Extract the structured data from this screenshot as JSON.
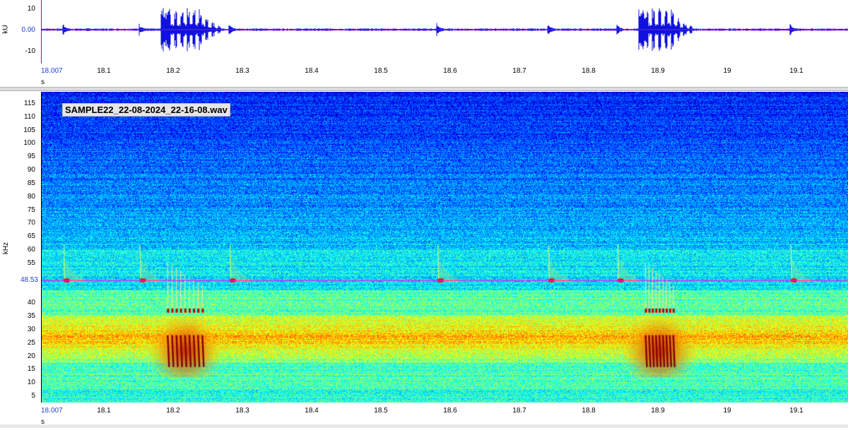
{
  "waveform": {
    "y_unit": "kU",
    "x_unit": "s",
    "y_ticks": [
      "10",
      "0.00",
      "-10"
    ],
    "y_ticks_values": [
      10,
      0,
      -10
    ],
    "y_range": [
      -15,
      15
    ],
    "x_start_label": "18.007",
    "x_ticks": [
      "18.1",
      "18.2",
      "18.3",
      "18.4",
      "18.5",
      "18.6",
      "18.7",
      "18.8",
      "18.9",
      "19",
      "19.1"
    ],
    "colors": {
      "signal": "#1010e0",
      "zero_line": "#c000c0",
      "axis": "#cc0066"
    }
  },
  "spectrogram": {
    "file_name": "SAMPLE22_22-08-2024_22-16-08.wav",
    "y_unit": "kHz",
    "x_unit": "s",
    "y_ticks": [
      "115",
      "110",
      "105",
      "100",
      "95",
      "90",
      "85",
      "80",
      "75",
      "70",
      "65",
      "60",
      "55",
      "40",
      "35",
      "30",
      "25",
      "20",
      "15",
      "10",
      "5"
    ],
    "cursor_value": "48.53",
    "x_start_label": "18.007",
    "x_ticks": [
      "18.1",
      "18.2",
      "18.3",
      "18.4",
      "18.5",
      "18.6",
      "18.7",
      "18.8",
      "18.9",
      "19",
      "19.1"
    ],
    "colors": {
      "cursor": "#ff00ff",
      "high": "#b00000",
      "low": "#0a1a9c"
    }
  },
  "chart_data": {
    "type": "heatmap",
    "x_range_s": [
      18.007,
      19.18
    ],
    "y_range_khz": [
      0,
      120
    ],
    "cursor_khz": 48.53,
    "echolocation_calls_s": [
      18.04,
      18.15,
      18.28,
      18.58,
      18.74,
      18.84,
      19.09
    ],
    "feeding_buzzes_s": [
      [
        18.19,
        18.24
      ],
      [
        18.88,
        18.92
      ]
    ]
  }
}
